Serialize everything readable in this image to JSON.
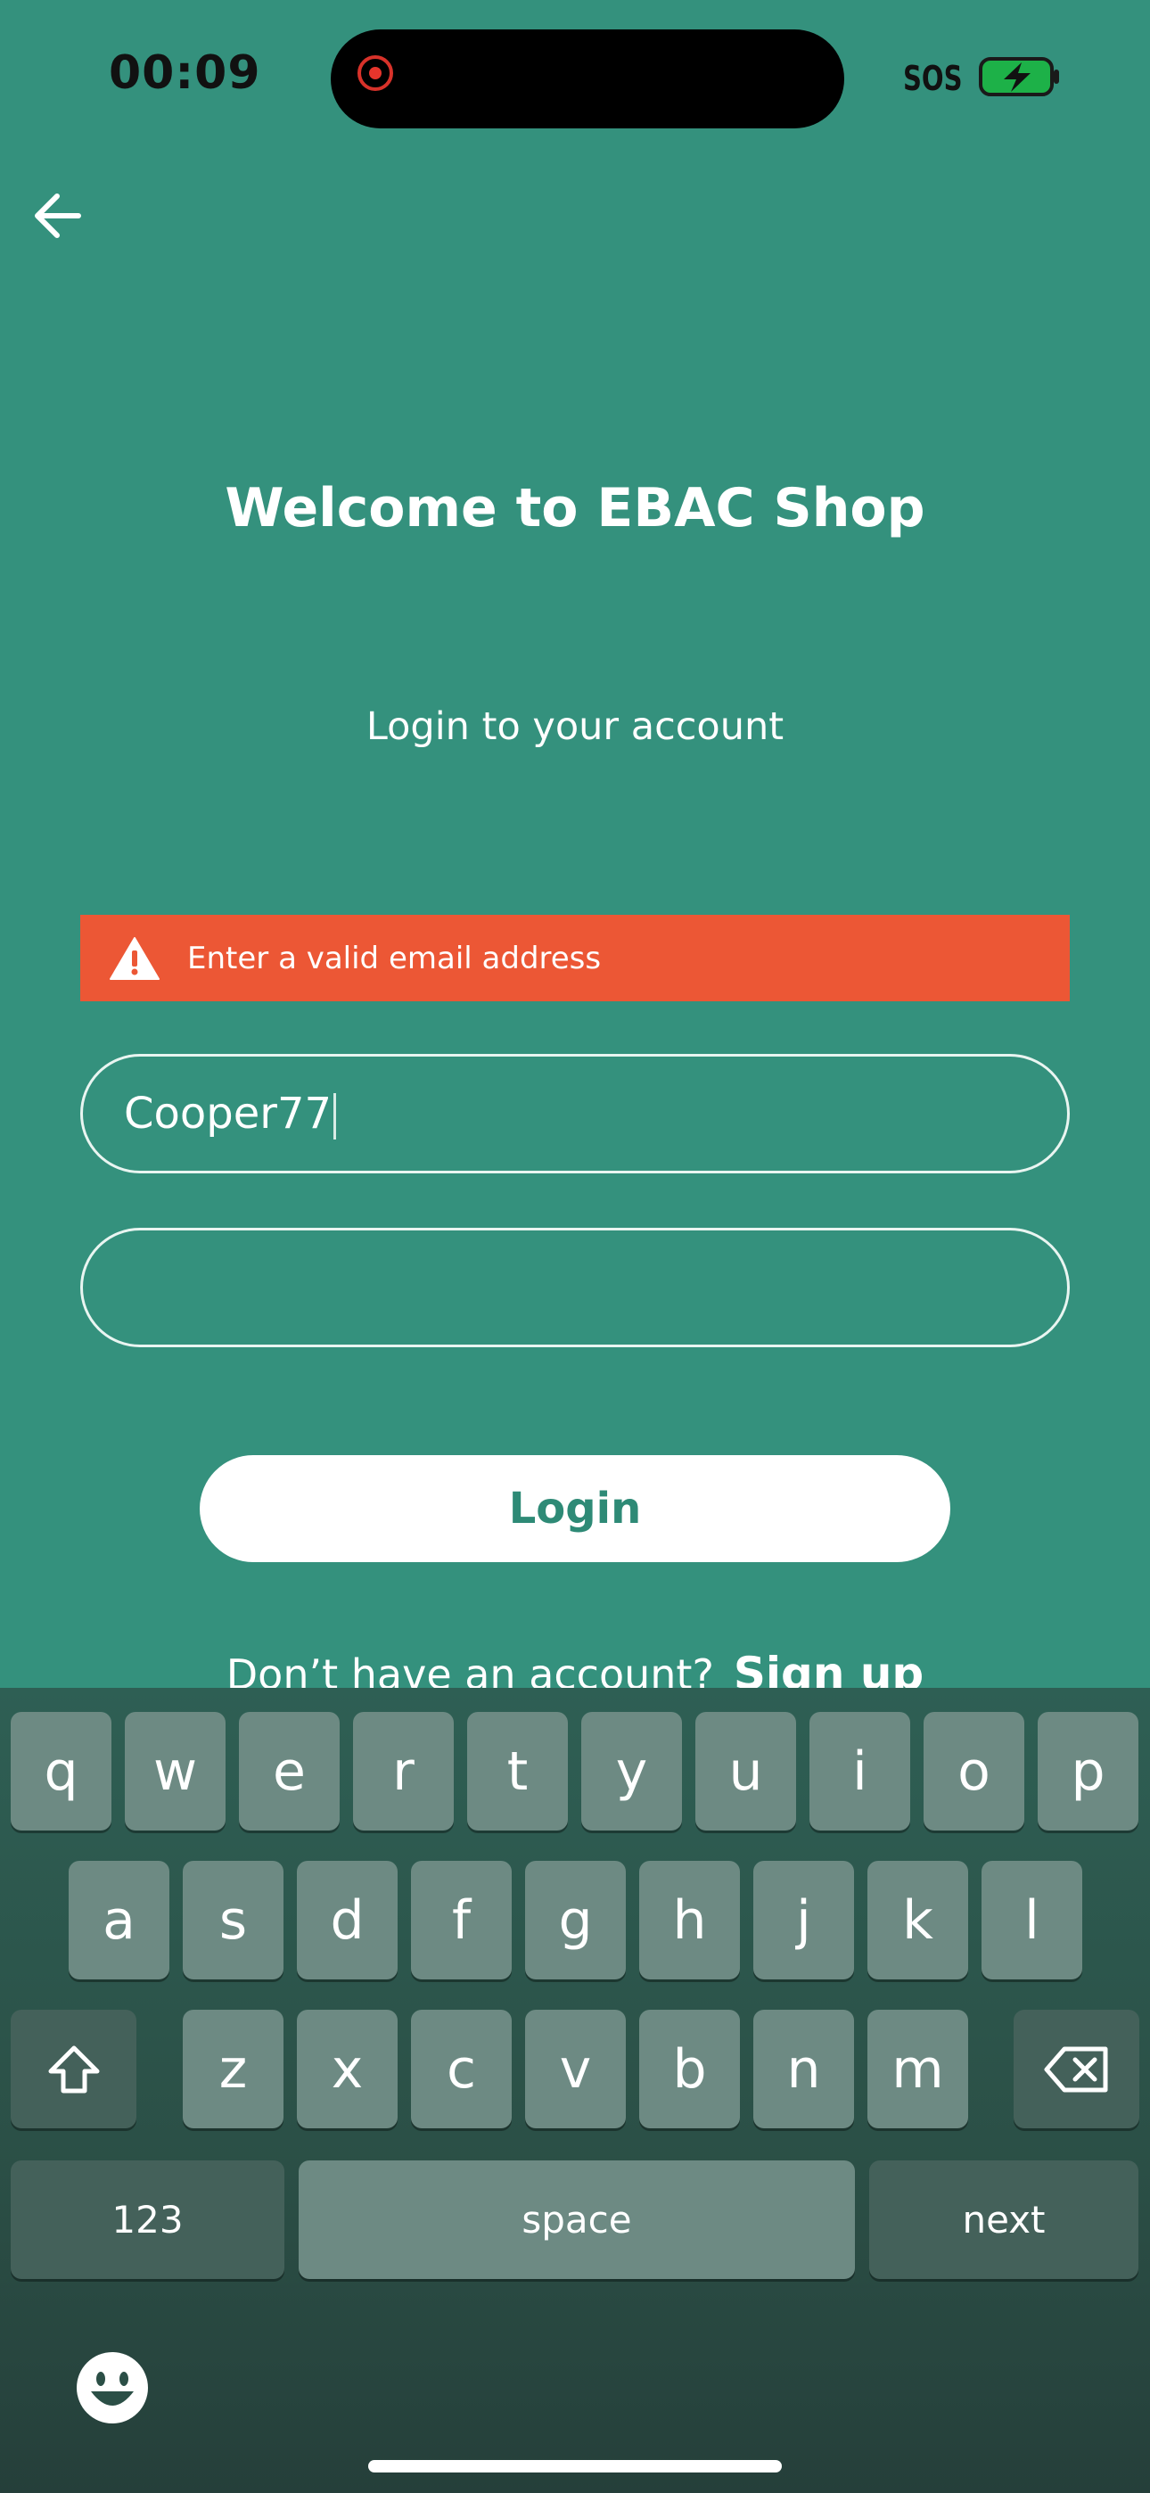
{
  "status_bar": {
    "time": "00:09",
    "sos": "SOS"
  },
  "icons": {
    "back": "arrow-left-icon",
    "warning": "warning-triangle-icon",
    "shift": "shift-icon",
    "delete": "backspace-icon",
    "emoji": "emoji-icon",
    "battery": "battery-charging-icon"
  },
  "colors": {
    "background": "#34917d",
    "error": "#ec5735",
    "button_text": "#2e8a76"
  },
  "screen": {
    "title": "Welcome to EBAC Shop",
    "subtitle": "Login to your account",
    "error_message": "Enter a valid email address",
    "email_value": "Cooper77",
    "password_value": "",
    "login_label": "Login",
    "signup_prompt": "Don’t have an account?",
    "signup_label": "Sign up"
  },
  "keyboard": {
    "row1": [
      "q",
      "w",
      "e",
      "r",
      "t",
      "y",
      "u",
      "i",
      "o",
      "p"
    ],
    "row2": [
      "a",
      "s",
      "d",
      "f",
      "g",
      "h",
      "j",
      "k",
      "l"
    ],
    "row3": [
      "z",
      "x",
      "c",
      "v",
      "b",
      "n",
      "m"
    ],
    "numbers_label": "123",
    "space_label": "space",
    "next_label": "next"
  }
}
